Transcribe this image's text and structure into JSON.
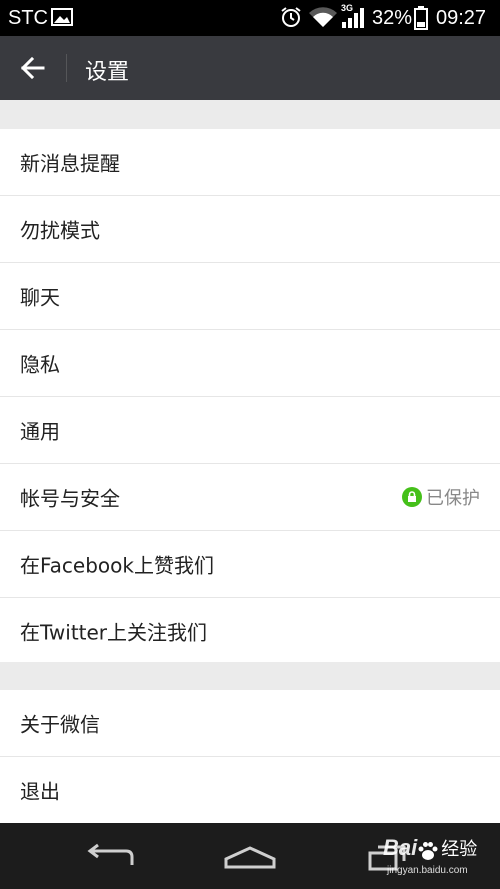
{
  "status_bar": {
    "carrier": "STC",
    "network": "3G",
    "battery": "32%",
    "time": "09:27"
  },
  "header": {
    "title": "设置",
    "back_icon": "arrow-left-icon"
  },
  "settings": {
    "group1": [
      {
        "label": "新消息提醒"
      },
      {
        "label": "勿扰模式"
      },
      {
        "label": "聊天"
      },
      {
        "label": "隐私"
      },
      {
        "label": "通用"
      },
      {
        "label": "帐号与安全",
        "status": "已保护"
      },
      {
        "label": "在Facebook上赞我们"
      },
      {
        "label": "在Twitter上关注我们"
      }
    ],
    "group2": [
      {
        "label": "关于微信"
      },
      {
        "label": "退出"
      }
    ]
  },
  "watermark": {
    "brand": "Bai",
    "brand_suffix": "经验",
    "url": "jingyan.baidu.com"
  },
  "colors": {
    "action_bar": "#393a3f",
    "status_bar": "#000000",
    "background": "#ebebeb",
    "accent_green": "#45c01a",
    "nav_bar": "#1c1c1c"
  }
}
